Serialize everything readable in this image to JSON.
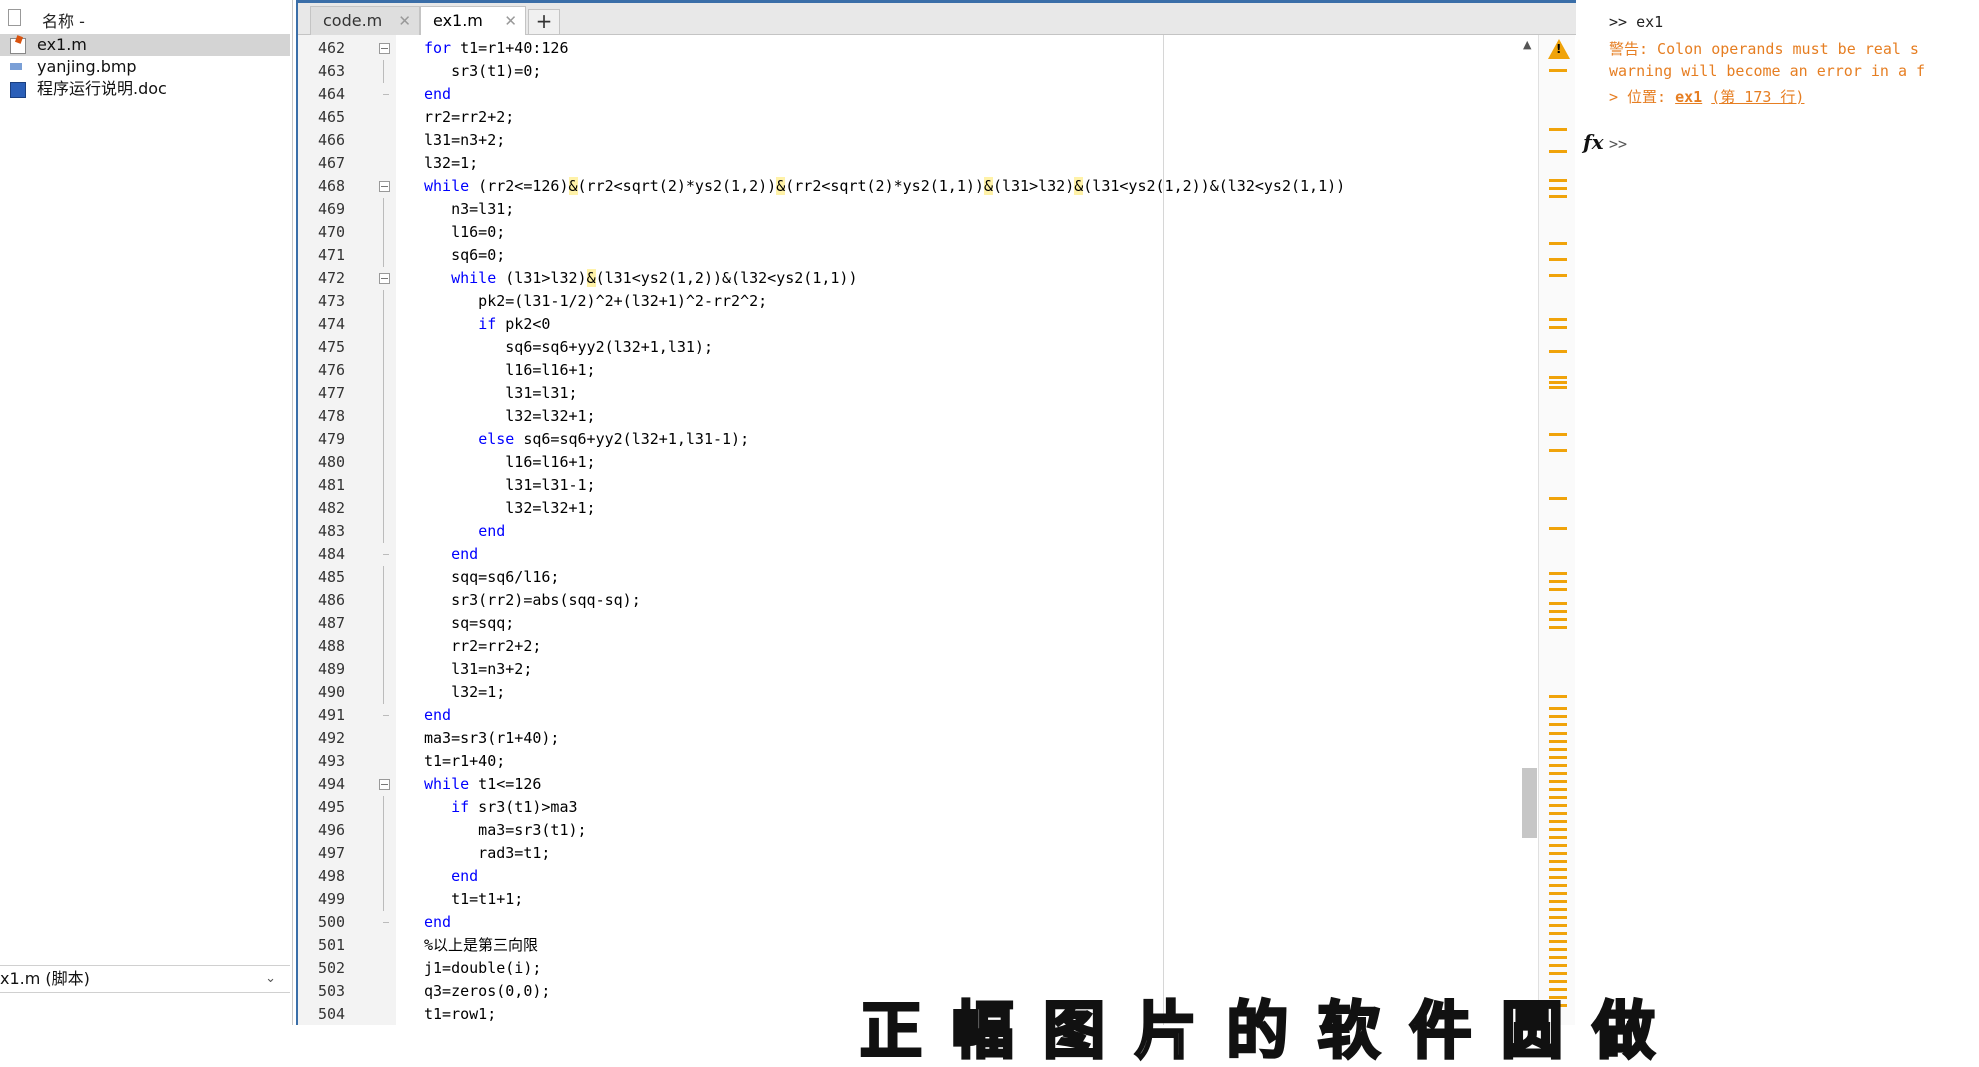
{
  "file_panel": {
    "header": "名称 -",
    "files": [
      {
        "name": "ex1.m",
        "icon": "matlab-file-icon",
        "selected": true
      },
      {
        "name": "yanjing.bmp",
        "icon": "image-file-icon",
        "selected": false
      },
      {
        "name": "程序运行说明.doc",
        "icon": "word-file-icon",
        "selected": false
      }
    ],
    "details_selector": "x1.m (脚本)"
  },
  "editor": {
    "tabs": [
      {
        "label": "code.m",
        "active": false
      },
      {
        "label": "ex1.m",
        "active": true
      }
    ],
    "add_tab": "+",
    "lines": [
      {
        "n": "462",
        "t": "for t1=r1+40:126"
      },
      {
        "n": "463",
        "t": "   sr3(t1)=0;"
      },
      {
        "n": "464",
        "t": "end"
      },
      {
        "n": "465",
        "t": "rr2=rr2+2;"
      },
      {
        "n": "466",
        "t": "l31=n3+2;"
      },
      {
        "n": "467",
        "t": "l32=1;"
      },
      {
        "n": "468",
        "t": "while (rr2<=126)&(rr2<sqrt(2)*ys2(1,2))&(rr2<sqrt(2)*ys2(1,1))&(l31>l32)&(l31<ys2(1,2))&(l32<ys2(1,1))"
      },
      {
        "n": "469",
        "t": "   n3=l31;"
      },
      {
        "n": "470",
        "t": "   l16=0;"
      },
      {
        "n": "471",
        "t": "   sq6=0;"
      },
      {
        "n": "472",
        "t": "   while (l31>l32)&(l31<ys2(1,2))&(l32<ys2(1,1))"
      },
      {
        "n": "473",
        "t": "      pk2=(l31-1/2)^2+(l32+1)^2-rr2^2;"
      },
      {
        "n": "474",
        "t": "      if pk2<0"
      },
      {
        "n": "475",
        "t": "         sq6=sq6+yy2(l32+1,l31);"
      },
      {
        "n": "476",
        "t": "         l16=l16+1;"
      },
      {
        "n": "477",
        "t": "         l31=l31;"
      },
      {
        "n": "478",
        "t": "         l32=l32+1;"
      },
      {
        "n": "479",
        "t": "      else sq6=sq6+yy2(l32+1,l31-1);"
      },
      {
        "n": "480",
        "t": "         l16=l16+1;"
      },
      {
        "n": "481",
        "t": "         l31=l31-1;"
      },
      {
        "n": "482",
        "t": "         l32=l32+1;"
      },
      {
        "n": "483",
        "t": "      end"
      },
      {
        "n": "484",
        "t": "   end"
      },
      {
        "n": "485",
        "t": "   sqq=sq6/l16;"
      },
      {
        "n": "486",
        "t": "   sr3(rr2)=abs(sqq-sq);"
      },
      {
        "n": "487",
        "t": "   sq=sqq;"
      },
      {
        "n": "488",
        "t": "   rr2=rr2+2;"
      },
      {
        "n": "489",
        "t": "   l31=n3+2;"
      },
      {
        "n": "490",
        "t": "   l32=1;"
      },
      {
        "n": "491",
        "t": "end"
      },
      {
        "n": "492",
        "t": "ma3=sr3(r1+40);"
      },
      {
        "n": "493",
        "t": "t1=r1+40;"
      },
      {
        "n": "494",
        "t": "while t1<=126"
      },
      {
        "n": "495",
        "t": "   if sr3(t1)>ma3"
      },
      {
        "n": "496",
        "t": "      ma3=sr3(t1);"
      },
      {
        "n": "497",
        "t": "      rad3=t1;"
      },
      {
        "n": "498",
        "t": "   end"
      },
      {
        "n": "499",
        "t": "   t1=t1+1;"
      },
      {
        "n": "500",
        "t": "end"
      },
      {
        "n": "501",
        "t": "%以上是第三向限"
      },
      {
        "n": "502",
        "t": "j1=double(i);"
      },
      {
        "n": "503",
        "t": "q3=zeros(0,0);"
      },
      {
        "n": "504",
        "t": "t1=row1;"
      }
    ]
  },
  "command_window": {
    "prompt_line": ">> ex1",
    "warning_line1": "警告: Colon operands must be real s",
    "warning_line2": "warning will become an error in a f",
    "location_prefix": "> 位置: ",
    "location_file": "ex1",
    "location_line": "(第 173 行)",
    "fx_label": "fx",
    "prompt": ">>"
  },
  "subtitle": "正 幅 图 片 的 软 件 圆 做",
  "colors": {
    "keyword": "#0000ff",
    "comment": "#228b22",
    "warning": "#e67e22",
    "editor_border": "#3a6ea8",
    "selection": "#d4d4d4"
  }
}
